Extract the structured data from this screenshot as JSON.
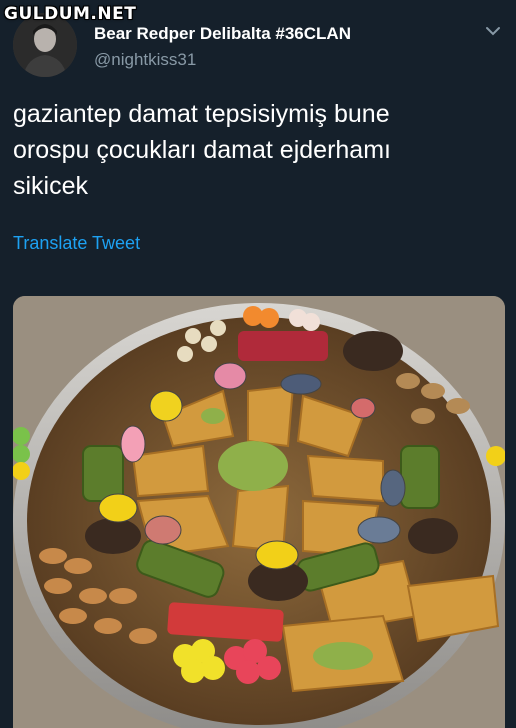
{
  "watermark": {
    "text": "GULDUM.NET"
  },
  "tweet": {
    "author": {
      "name": "Bear Redper Delibalta #36CLAN",
      "handle": "@nightkiss31",
      "avatar_icon": "profile-photo-icon"
    },
    "menu_icon": "chevron-down-icon",
    "text_lines": [
      "gaziantep damat tepsisiymiş bune",
      "orospu çocukları damat ejderhamı",
      "sikicek"
    ],
    "translate_label": "Translate Tweet",
    "media_icon": "dessert-tray-photo"
  },
  "colors": {
    "background": "#15202b",
    "secondary_text": "#8899a6",
    "link": "#1da1f2"
  }
}
